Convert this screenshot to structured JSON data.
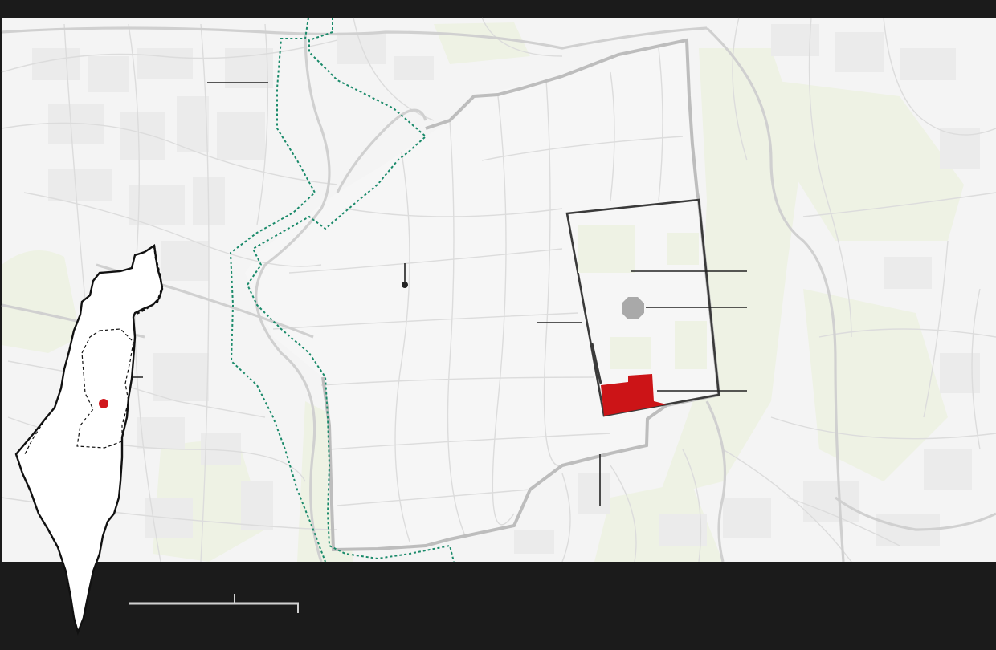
{
  "map": {
    "colors": {
      "frame_background": "#1b1b1b",
      "map_background": "#f4f4f4",
      "street_line": "#dcdcdc",
      "major_road": "#d0d0d0",
      "block_fill": "#ebebeb",
      "green_area": "#eef2e4",
      "old_city_fill": "#f6f6f6",
      "old_city_wall": "#bdbdbd",
      "green_line": "#1a8a6a",
      "compound_outline": "#3a3a3a",
      "highlight_red": "#cc1417",
      "dome_gray": "#a9a9a9",
      "callout_line": "#222222",
      "inset_fill": "#ffffff",
      "inset_outline": "#111111",
      "inset_marker": "#d0161b",
      "scale_bar": "#d0d0d0"
    },
    "layers": [
      "street-grid",
      "green-areas",
      "old-city-walls",
      "green-line-boundary",
      "holy-compound-outline",
      "highlighted-plaza",
      "dome-marker",
      "callout-leaders",
      "locator-inset",
      "scale-bar"
    ],
    "icons": [
      "location-pin-icon",
      "octagon-dome-icon"
    ],
    "inset": {
      "shape": "israel-outline",
      "marker": "jerusalem-dot"
    }
  }
}
